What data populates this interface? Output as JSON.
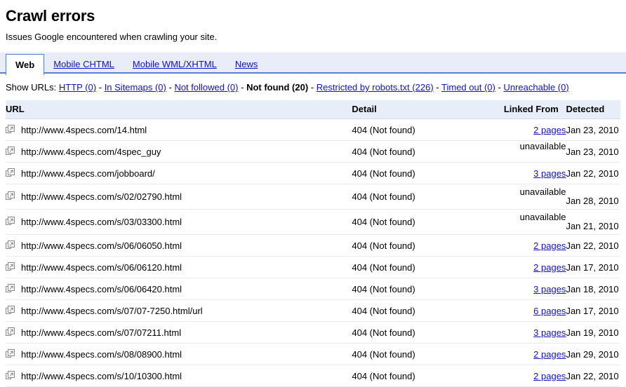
{
  "header": {
    "title": "Crawl errors",
    "subtitle": "Issues Google encountered when crawling your site."
  },
  "tabs": [
    {
      "label": "Web",
      "active": true
    },
    {
      "label": "Mobile CHTML",
      "active": false
    },
    {
      "label": "Mobile WML/XHTML",
      "active": false
    },
    {
      "label": "News",
      "active": false
    }
  ],
  "filters": {
    "label": "Show URLs:",
    "separator": "-",
    "items": [
      {
        "label": "HTTP (0)",
        "current": false
      },
      {
        "label": "In Sitemaps (0)",
        "current": false
      },
      {
        "label": "Not followed (0)",
        "current": false
      },
      {
        "label": "Not found (20)",
        "current": true
      },
      {
        "label": "Restricted by robots.txt (226)",
        "current": false
      },
      {
        "label": "Timed out (0)",
        "current": false
      },
      {
        "label": "Unreachable (0)",
        "current": false
      }
    ]
  },
  "table": {
    "columns": {
      "url": "URL",
      "detail": "Detail",
      "linked_from": "Linked From",
      "detected": "Detected"
    },
    "icon": "external-link-icon",
    "rows": [
      {
        "url": "http://www.4specs.com/14.html",
        "detail": "404 (Not found)",
        "linked_from": "2 pages",
        "linked_is_link": true,
        "detected": "Jan 23, 2010"
      },
      {
        "url": "http://www.4specs.com/4spec_guy",
        "detail": "404 (Not found)",
        "linked_from": "unavailable",
        "linked_is_link": false,
        "detected": "Jan 23, 2010"
      },
      {
        "url": "http://www.4specs.com/jobboard/",
        "detail": "404 (Not found)",
        "linked_from": "3 pages",
        "linked_is_link": true,
        "detected": "Jan 22, 2010"
      },
      {
        "url": "http://www.4specs.com/s/02/02790.html",
        "detail": "404 (Not found)",
        "linked_from": "unavailable",
        "linked_is_link": false,
        "detected": "Jan 28, 2010"
      },
      {
        "url": "http://www.4specs.com/s/03/03300.html",
        "detail": "404 (Not found)",
        "linked_from": "unavailable",
        "linked_is_link": false,
        "detected": "Jan 21, 2010"
      },
      {
        "url": "http://www.4specs.com/s/06/06050.html",
        "detail": "404 (Not found)",
        "linked_from": "2 pages",
        "linked_is_link": true,
        "detected": "Jan 22, 2010"
      },
      {
        "url": "http://www.4specs.com/s/06/06120.html",
        "detail": "404 (Not found)",
        "linked_from": "2 pages",
        "linked_is_link": true,
        "detected": "Jan 17, 2010"
      },
      {
        "url": "http://www.4specs.com/s/06/06420.html",
        "detail": "404 (Not found)",
        "linked_from": "3 pages",
        "linked_is_link": true,
        "detected": "Jan 18, 2010"
      },
      {
        "url": "http://www.4specs.com/s/07/07-7250.html/url",
        "detail": "404 (Not found)",
        "linked_from": "6 pages",
        "linked_is_link": true,
        "detected": "Jan 17, 2010"
      },
      {
        "url": "http://www.4specs.com/s/07/07211.html",
        "detail": "404 (Not found)",
        "linked_from": "3 pages",
        "linked_is_link": true,
        "detected": "Jan 19, 2010"
      },
      {
        "url": "http://www.4specs.com/s/08/08900.html",
        "detail": "404 (Not found)",
        "linked_from": "2 pages",
        "linked_is_link": true,
        "detected": "Jan 29, 2010"
      },
      {
        "url": "http://www.4specs.com/s/10/10300.html",
        "detail": "404 (Not found)",
        "linked_from": "2 pages",
        "linked_is_link": true,
        "detected": "Jan 22, 2010"
      }
    ]
  },
  "colors": {
    "link": "#1111cc",
    "tab_band": "#e8edf9",
    "tab_border": "#5b7fd0",
    "header_bg": "#e8eef9",
    "row_divider": "#e9ecef"
  }
}
